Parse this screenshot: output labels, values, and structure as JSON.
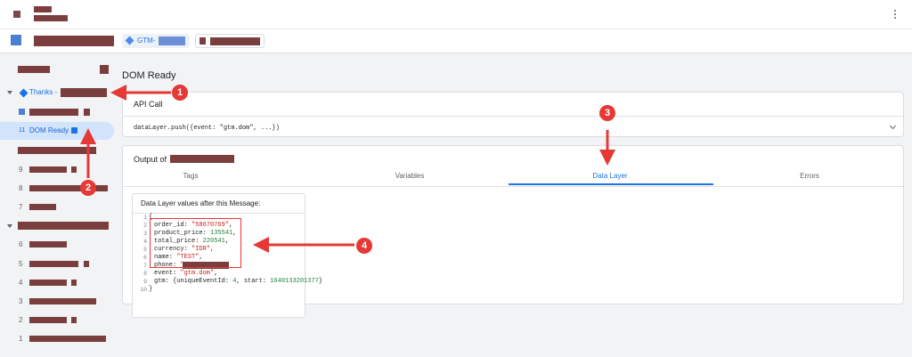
{
  "tabs": {
    "gtm_prefix": "GTM-"
  },
  "sidebar": {
    "thanks_label": "Thanks -",
    "selected_num": "11",
    "selected_label": "DOM Ready",
    "nums": [
      "9",
      "8",
      "7",
      "6",
      "5",
      "4",
      "3",
      "2",
      "1"
    ]
  },
  "main": {
    "title": "DOM Ready",
    "api_card_title": "API Call",
    "api_code": "dataLayer.push({event: \"gtm.dom\", ...})",
    "output_title": "Output of",
    "output_tabs": [
      "Tags",
      "Variables",
      "Data Layer",
      "Errors"
    ],
    "data_layer_header": "Data Layer values after this Message:",
    "code_lines": [
      "{",
      "order_id: \"58670769\",",
      "product_price: 135541,",
      "total_price: 220541,",
      "currency: \"IDR\",",
      "name: \"TEST\",",
      "phone: \"",
      "event: \"gtm.dom\",",
      "gtm: {uniqueEventId: 4, start: 1640133201377}",
      "}"
    ],
    "line_numbers": [
      "1",
      "2",
      "3",
      "4",
      "5",
      "6",
      "7",
      "8",
      "9",
      "10"
    ]
  },
  "annotations": [
    "1",
    "2",
    "3",
    "4"
  ],
  "colors": {
    "accent": "#1a73e8",
    "annotation": "#e53935",
    "redaction": "#7a3e3e"
  }
}
